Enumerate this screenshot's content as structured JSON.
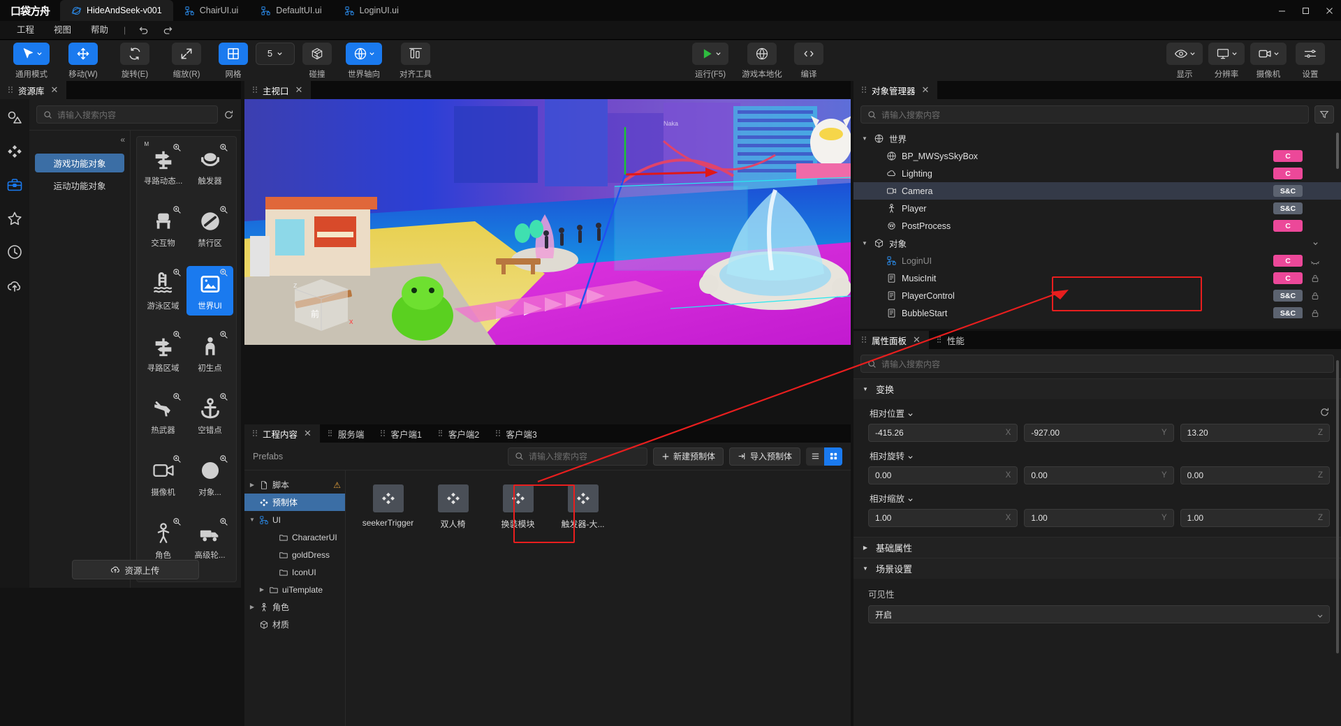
{
  "window": {
    "logo": "口袋方舟",
    "tabs": [
      {
        "label": "HideAndSeek-v001",
        "icon": "planet-icon",
        "active": true
      },
      {
        "label": "ChairUI.ui",
        "icon": "ui-node-icon",
        "active": false
      },
      {
        "label": "DefaultUI.ui",
        "icon": "ui-node-icon",
        "active": false
      },
      {
        "label": "LoginUI.ui",
        "icon": "ui-node-icon",
        "active": false
      }
    ],
    "controls": {
      "minimize": "─",
      "maximize": "☐",
      "close": "✕"
    }
  },
  "menu": {
    "items": [
      "工程",
      "视图",
      "帮助"
    ],
    "separator": "|",
    "undo": "undo-icon",
    "redo": "redo-icon"
  },
  "toolbar": {
    "left": [
      {
        "label": "通用模式",
        "icon": "cursor-icon",
        "accent": true,
        "dropdown": true
      },
      {
        "label": "移动(W)",
        "icon": "move-icon",
        "accent": true,
        "dropdown": false
      },
      {
        "label": "旋转(E)",
        "icon": "rotate-icon",
        "accent": false,
        "dropdown": false
      },
      {
        "label": "缩放(R)",
        "icon": "scale-icon",
        "accent": false,
        "dropdown": false
      },
      {
        "label": "网格",
        "icon": "grid-icon",
        "accent": true,
        "dropdown": false
      },
      {
        "label": "",
        "icon": "number-dropdown",
        "value": "5",
        "accent": false,
        "dropdown": true
      },
      {
        "label": "碰撞",
        "icon": "collision-icon",
        "accent": false,
        "dropdown": false
      },
      {
        "label": "世界轴向",
        "icon": "world-axis-icon",
        "accent": true,
        "dropdown": true
      },
      {
        "label": "对齐工具",
        "icon": "align-icon",
        "accent": false,
        "dropdown": false
      }
    ],
    "center": [
      {
        "label": "运行(F5)",
        "icon": "play-icon",
        "dropdown": true
      },
      {
        "label": "游戏本地化",
        "icon": "globe-icon",
        "dropdown": false
      },
      {
        "label": "编译",
        "icon": "code-icon",
        "dropdown": false
      }
    ],
    "right": [
      {
        "label": "显示",
        "icon": "eye-icon",
        "dropdown": true
      },
      {
        "label": "分辨率",
        "icon": "monitor-icon",
        "dropdown": true
      },
      {
        "label": "摄像机",
        "icon": "camera-icon",
        "dropdown": true
      },
      {
        "label": "设置",
        "icon": "sliders-icon",
        "dropdown": false
      }
    ]
  },
  "asset_library": {
    "tab": "资源库",
    "close": "✕",
    "search_placeholder": "请输入搜索内容",
    "refresh_icon": "refresh-icon",
    "rail": [
      {
        "name": "shapes-icon",
        "active": false
      },
      {
        "name": "prefab-icon",
        "active": false
      },
      {
        "name": "toolbox-icon",
        "active": true
      },
      {
        "name": "star-icon",
        "active": false
      },
      {
        "name": "clock-icon",
        "active": false
      },
      {
        "name": "cloud-upload-icon",
        "active": false
      }
    ],
    "collapse": "«",
    "categories": [
      {
        "label": "游戏功能对象",
        "active": true
      },
      {
        "label": "运动功能对象",
        "active": false
      }
    ],
    "items": [
      {
        "label": "寻路动态...",
        "icon": "signpost-icon",
        "selected": false,
        "badge": "M"
      },
      {
        "label": "触发器",
        "icon": "trigger-icon",
        "selected": false
      },
      {
        "label": "交互物",
        "icon": "interactive-icon",
        "selected": false
      },
      {
        "label": "禁行区",
        "icon": "no-entry-icon",
        "selected": false
      },
      {
        "label": "游泳区域",
        "icon": "pool-icon",
        "selected": false
      },
      {
        "label": "世界UI",
        "icon": "world-ui-icon",
        "selected": true
      },
      {
        "label": "寻路区域",
        "icon": "signpost-icon",
        "selected": false
      },
      {
        "label": "初生点",
        "icon": "spawn-icon",
        "selected": false
      },
      {
        "label": "热武器",
        "icon": "gun-icon",
        "selected": false
      },
      {
        "label": "空错点",
        "icon": "anchor-icon",
        "selected": false
      },
      {
        "label": "摄像机",
        "icon": "camera-icon",
        "selected": false
      },
      {
        "label": "对象...",
        "icon": "sphere-icon",
        "selected": false
      },
      {
        "label": "角色",
        "icon": "person-icon",
        "selected": false
      },
      {
        "label": "高级轮...",
        "icon": "truck-icon",
        "selected": false
      }
    ],
    "upload_button": "资源上传",
    "upload_icon": "cloud-upload-icon"
  },
  "viewport": {
    "tab": "主视口",
    "close": "✕",
    "gizmo_labels": {
      "z": "z",
      "x": "x",
      "front": "前"
    }
  },
  "content_panel": {
    "tabs": [
      {
        "label": "工程内容",
        "active": true,
        "closable": true
      },
      {
        "label": "服务端",
        "active": false
      },
      {
        "label": "客户端1",
        "active": false
      },
      {
        "label": "客户端2",
        "active": false
      },
      {
        "label": "客户端3",
        "active": false
      }
    ],
    "close": "✕",
    "breadcrumb": "Prefabs",
    "search_placeholder": "请输入搜索内容",
    "new_prefab_button": "新建预制体",
    "import_prefab_button": "导入预制体",
    "view_list_icon": "list-view-icon",
    "view_grid_icon": "grid-view-icon",
    "tree": [
      {
        "label": "脚本",
        "icon": "file-icon",
        "indent": 0,
        "arrow": "▶",
        "warning": true,
        "selected": false
      },
      {
        "label": "预制体",
        "icon": "prefab-icon",
        "indent": 0,
        "arrow": "",
        "selected": true
      },
      {
        "label": "UI",
        "icon": "ui-node-icon",
        "indent": 0,
        "arrow": "▼",
        "selected": false
      },
      {
        "label": "CharacterUI",
        "icon": "folder-icon",
        "indent": 2,
        "arrow": "",
        "selected": false
      },
      {
        "label": "goldDress",
        "icon": "folder-icon",
        "indent": 2,
        "arrow": "",
        "selected": false
      },
      {
        "label": "IconUI",
        "icon": "folder-icon",
        "indent": 2,
        "arrow": "",
        "selected": false
      },
      {
        "label": "uiTemplate",
        "icon": "folder-icon",
        "indent": 1,
        "arrow": "▶",
        "selected": false
      },
      {
        "label": "角色",
        "icon": "person-icon",
        "indent": 0,
        "arrow": "▶",
        "selected": false
      },
      {
        "label": "材质",
        "icon": "cube-icon",
        "indent": 0,
        "arrow": "",
        "selected": false
      }
    ],
    "prefabs": [
      {
        "label": "seekerTrigger",
        "icon": "prefab-icon",
        "selected": false
      },
      {
        "label": "双人椅",
        "icon": "prefab-icon",
        "selected": true
      },
      {
        "label": "换装模块",
        "icon": "prefab-icon",
        "selected": false
      },
      {
        "label": "触发器-大...",
        "icon": "prefab-icon",
        "selected": false
      }
    ]
  },
  "object_manager": {
    "tab": "对象管理器",
    "close": "✕",
    "search_placeholder": "请输入搜索内容",
    "filter_icon": "filter-icon",
    "rows": [
      {
        "label": "世界",
        "icon": "world-icon",
        "indent": 0,
        "arrow": "▼",
        "badge": "",
        "selected": false,
        "dim": false
      },
      {
        "label": "BP_MWSysSkyBox",
        "icon": "globe-icon",
        "indent": 1,
        "arrow": "",
        "badge": "C",
        "badge_type": "c",
        "selected": false,
        "dim": false
      },
      {
        "label": "Lighting",
        "icon": "cloud-icon",
        "indent": 1,
        "arrow": "",
        "badge": "C",
        "badge_type": "c",
        "selected": false,
        "dim": false
      },
      {
        "label": "Camera",
        "icon": "camera-icon",
        "indent": 1,
        "arrow": "",
        "badge": "S&C",
        "badge_type": "sc",
        "selected": true,
        "dim": false
      },
      {
        "label": "Player",
        "icon": "person-icon",
        "indent": 1,
        "arrow": "",
        "badge": "S&C",
        "badge_type": "sc",
        "selected": false,
        "dim": false
      },
      {
        "label": "PostProcess",
        "icon": "postprocess-icon",
        "indent": 1,
        "arrow": "",
        "badge": "C",
        "badge_type": "c",
        "selected": false,
        "dim": false
      },
      {
        "label": "对象",
        "icon": "cube-icon",
        "indent": 0,
        "arrow": "▼",
        "badge": "",
        "selected": false,
        "dim": false,
        "chevron": true
      },
      {
        "label": "LoginUI",
        "icon": "ui-node-icon",
        "indent": 1,
        "arrow": "",
        "badge": "C",
        "badge_type": "c",
        "selected": false,
        "dim": true,
        "eye": "eye-off-icon"
      },
      {
        "label": "MusicInit",
        "icon": "script-icon",
        "indent": 1,
        "arrow": "",
        "badge": "C",
        "badge_type": "c",
        "selected": false,
        "dim": false,
        "eye": "lock-icon"
      },
      {
        "label": "PlayerControl",
        "icon": "script-icon",
        "indent": 1,
        "arrow": "",
        "badge": "S&C",
        "badge_type": "sc",
        "selected": false,
        "dim": false,
        "eye": "lock-icon"
      },
      {
        "label": "BubbleStart",
        "icon": "script-icon",
        "indent": 1,
        "arrow": "",
        "badge": "S&C",
        "badge_type": "sc",
        "selected": false,
        "dim": false,
        "eye": "lock-icon"
      }
    ]
  },
  "property_panel": {
    "tabs": [
      {
        "label": "属性面板",
        "active": true,
        "closable": true
      },
      {
        "label": "性能",
        "active": false
      }
    ],
    "close": "✕",
    "search_placeholder": "请输入搜索内容",
    "sections": [
      {
        "label": "变换",
        "expanded": true
      },
      {
        "label": "基础属性",
        "expanded": false
      },
      {
        "label": "场景设置",
        "expanded": true
      }
    ],
    "transform": {
      "position": {
        "label": "相对位置",
        "x": "-415.26",
        "y": "-927.00",
        "z": "13.20"
      },
      "rotation": {
        "label": "相对旋转",
        "x": "0.00",
        "y": "0.00",
        "z": "0.00"
      },
      "scale": {
        "label": "相对缩放",
        "x": "1.00",
        "y": "1.00",
        "z": "1.00"
      },
      "axis_x": "X",
      "axis_y": "Y",
      "axis_z": "Z",
      "reset_icon": "reset-icon"
    },
    "scene_settings": {
      "visibility_label": "可见性",
      "visibility_value": "开启"
    }
  },
  "colors": {
    "accent": "#1a7aef",
    "select_blue": "#3b6ea5",
    "badge_c": "#ec4899",
    "badge_sc": "#5c6370",
    "annotation_red": "#e81e1e",
    "play_green": "#2ebd3f",
    "warning": "#e8a33d"
  }
}
